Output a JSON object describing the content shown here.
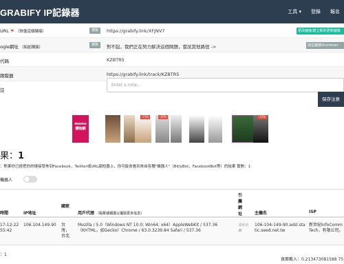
{
  "navbar": {
    "brand": "GRABIFY IP記錄器",
    "items": [
      "工具 ▾",
      "登錄",
      "報名"
    ]
  },
  "form": {
    "rows": [
      {
        "label": "URL",
        "red": "⚑",
        "note": "（恢復這個鏈接）",
        "btn": "複製",
        "value": "https://grabify.link/XFJNV7",
        "action": "更改鏈接/建立新的更新鏈接"
      },
      {
        "label": "ogle網址",
        "note": "（如此鏈接）",
        "btn": "複製",
        "value": "對不起，我們正在努力解決這個問題，嘗試其他路徑 ->",
        "action": "與這鏈接Shortener"
      },
      {
        "label": "代碼",
        "value": "KZBTR5"
      },
      {
        "label": "跟蹤器",
        "value": "https://grabify.link/track/KZBTR5"
      },
      {
        "label": "註"
      }
    ],
    "note_placeholder": "Enter a note...",
    "save_label": "保存注意"
  },
  "ads": {
    "brand_text": "momo\n購物網",
    "tags": [
      "-15%",
      "-35%",
      "-12%"
    ]
  },
  "results": {
    "title_prefix": "果：",
    "count": "1",
    "info": "：對果你已經把你的鏈接發佈到Facebook，Twitter或URL縮短器上，你可能會看到來自各種\"機器人\"（BitlyBot，FacebookBot等）的結果 實數：1",
    "toggle_label": "機器人"
  },
  "table": {
    "headers": {
      "time": "時間",
      "ip": "IP地址",
      "country": "國家",
      "ua": "用戶代理",
      "ua_note": "（點擊或觸摸以獲取更多信息）",
      "referrer": "引薦網址",
      "host": "主機名",
      "isp": "ISP"
    },
    "row": {
      "time": "17-12-22\n55:42",
      "ip": "106.104.149.90",
      "country": "台灣，台北",
      "ua": "Mozilla / 5.0（Windows NT 10.0; Win64; x64）AppleWebKit / 537.36（KHTML，如Gecko）Chrome / 63.0.3239.84 Safari / 537.36",
      "referrer": "沒有引薦",
      "host": "106-104-149-90.adsl.static.seed.net.tw",
      "isp": "新世紀InfoComm Tech，有限公司。"
    }
  },
  "footer": {
    "left": "：1",
    "right": "頁面載入：0.213473081588 75"
  }
}
